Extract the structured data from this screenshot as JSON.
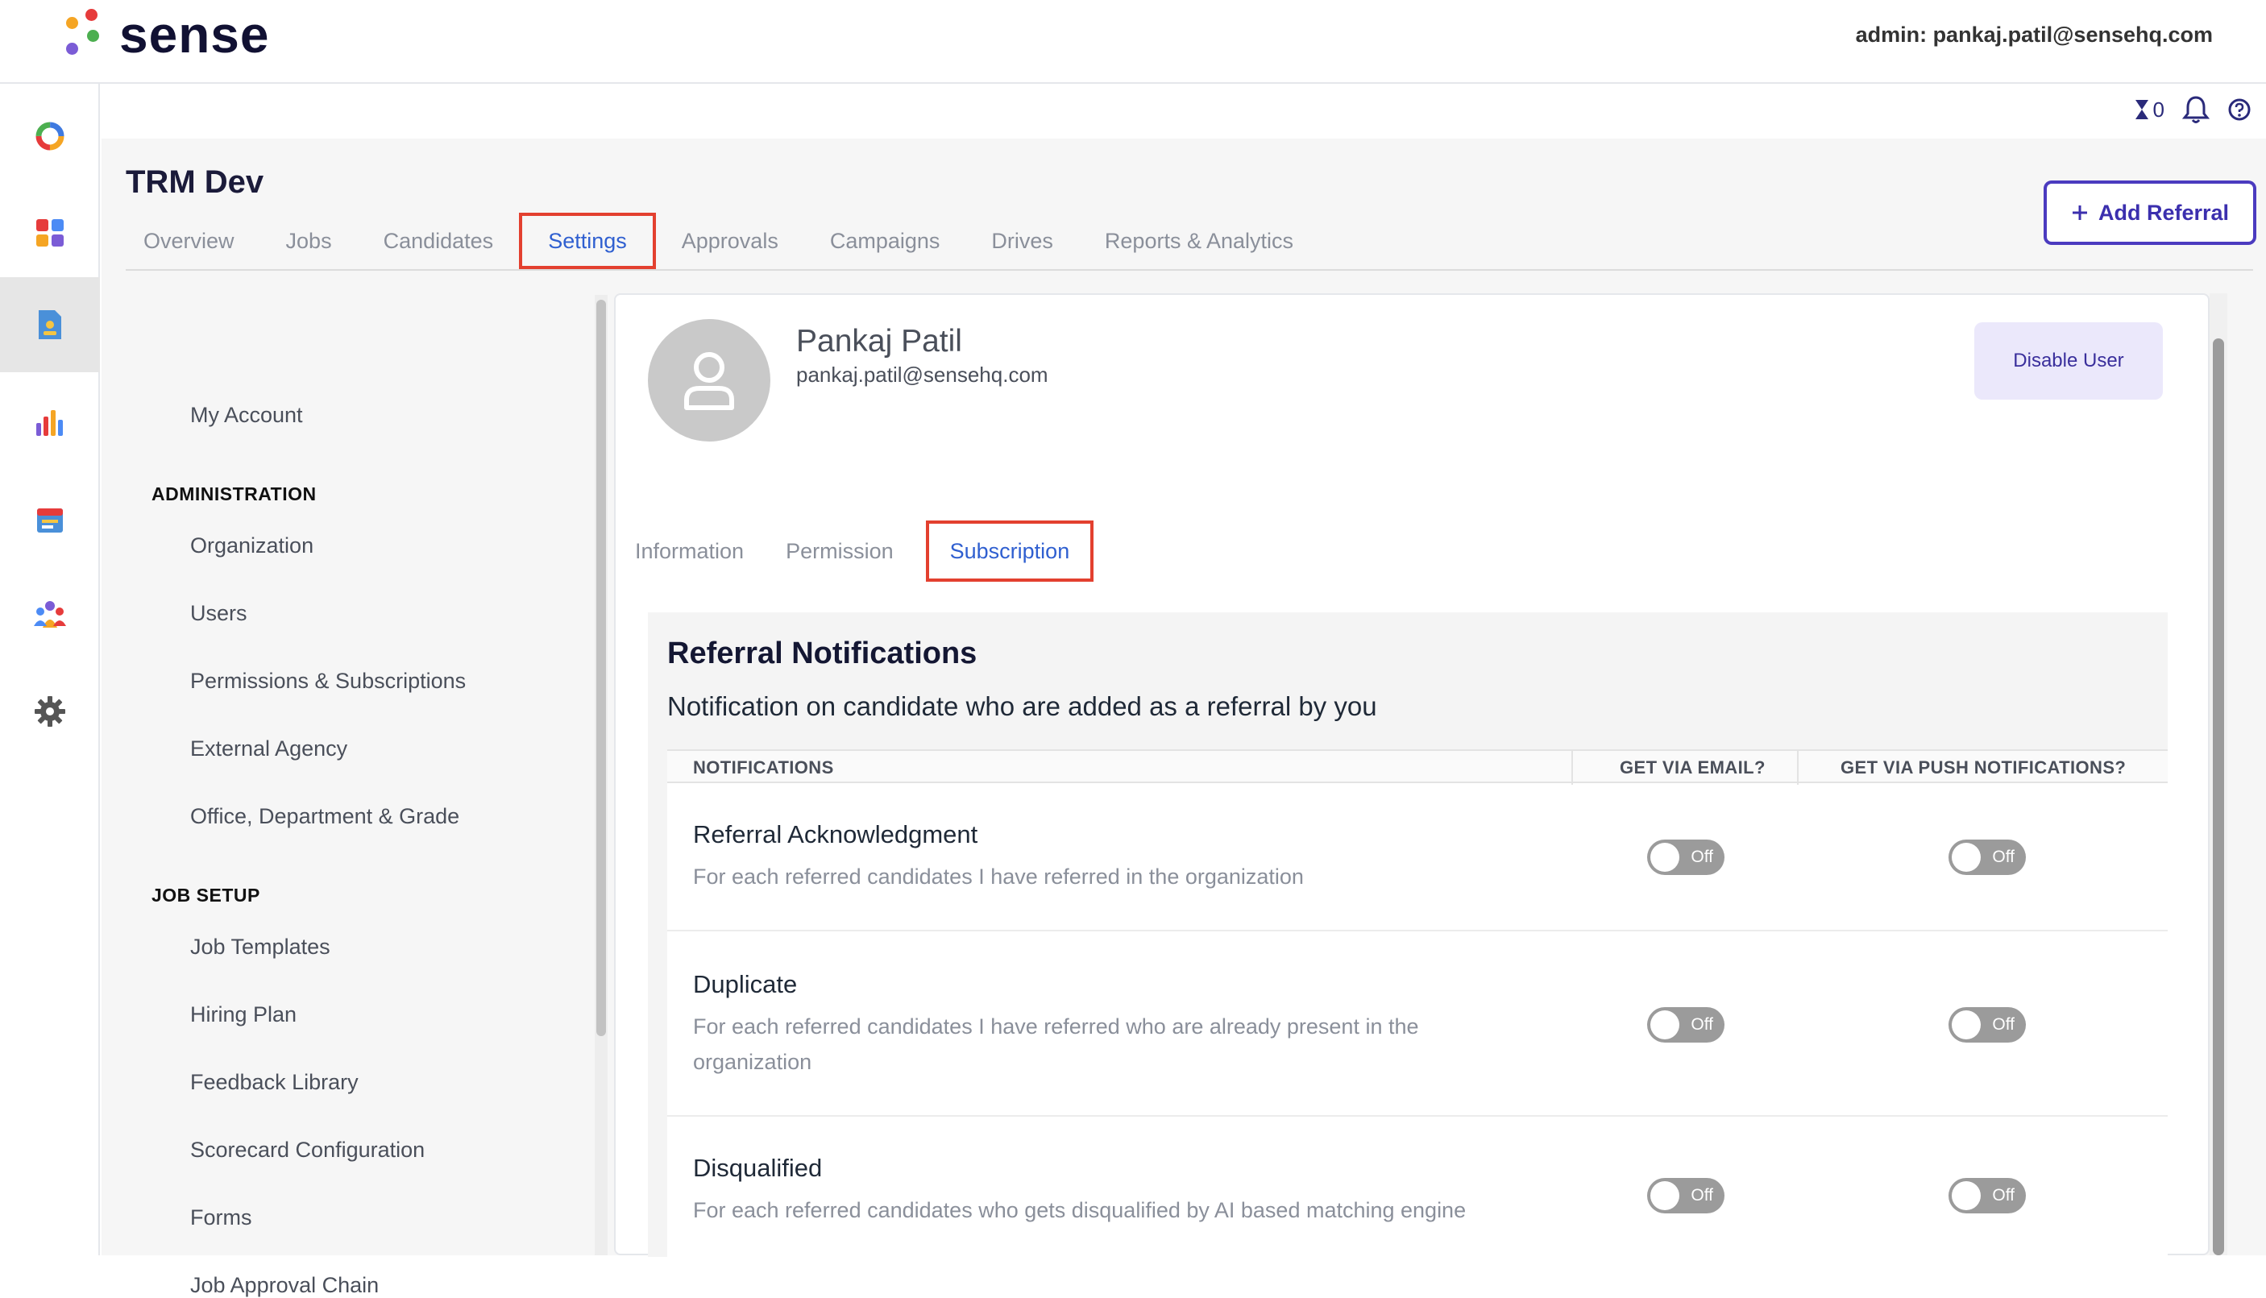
{
  "header": {
    "brand": "sense",
    "admin_label": "admin: pankaj.patil@sensehq.com",
    "brand_colors": [
      "#f5a524",
      "#e63b3b",
      "#4caf50",
      "#7b5cd6"
    ]
  },
  "rail": {
    "items": [
      {
        "name": "dashboard-ring-icon"
      },
      {
        "name": "apps-grid-icon"
      },
      {
        "name": "referral-document-icon",
        "active": true
      },
      {
        "name": "bar-chart-icon"
      },
      {
        "name": "calendar-icon"
      },
      {
        "name": "people-icon"
      },
      {
        "name": "gear-icon"
      }
    ]
  },
  "utility": {
    "timer_count": "0"
  },
  "org": {
    "title": "TRM Dev"
  },
  "nav": {
    "tabs": [
      "Overview",
      "Jobs",
      "Candidates",
      "Settings",
      "Approvals",
      "Campaigns",
      "Drives",
      "Reports & Analytics"
    ],
    "active": "Settings"
  },
  "actions": {
    "add_referral": "Add Referral"
  },
  "settings_nav": {
    "my_account": "My Account",
    "administration_heading": "ADMINISTRATION",
    "administration": [
      "Organization",
      "Users",
      "Permissions & Subscriptions",
      "External Agency",
      "Office, Department & Grade"
    ],
    "job_setup_heading": "JOB SETUP",
    "job_setup": [
      "Job Templates",
      "Hiring Plan",
      "Feedback Library",
      "Scorecard Configuration",
      "Forms",
      "Job Approval Chain"
    ]
  },
  "user": {
    "name": "Pankaj Patil",
    "email": "pankaj.patil@sensehq.com",
    "disable_label": "Disable User"
  },
  "sub_tabs": {
    "tabs": [
      "Information",
      "Permission",
      "Subscription"
    ],
    "active": "Subscription"
  },
  "section": {
    "title": "Referral Notifications",
    "subtitle": "Notification on candidate who are added as a referral by you",
    "columns": [
      "NOTIFICATIONS",
      "GET VIA EMAIL?",
      "GET VIA PUSH NOTIFICATIONS?"
    ],
    "rows": [
      {
        "title": "Referral Acknowledgment",
        "desc": "For each referred candidates I have referred in the organization",
        "email": "Off",
        "push": "Off"
      },
      {
        "title": "Duplicate",
        "desc": "For each referred candidates I have referred who are already present in the organization",
        "email": "Off",
        "push": "Off"
      },
      {
        "title": "Disqualified",
        "desc": "For each referred candidates who gets disqualified by AI based matching engine",
        "email": "Off",
        "push": "Off"
      }
    ]
  }
}
